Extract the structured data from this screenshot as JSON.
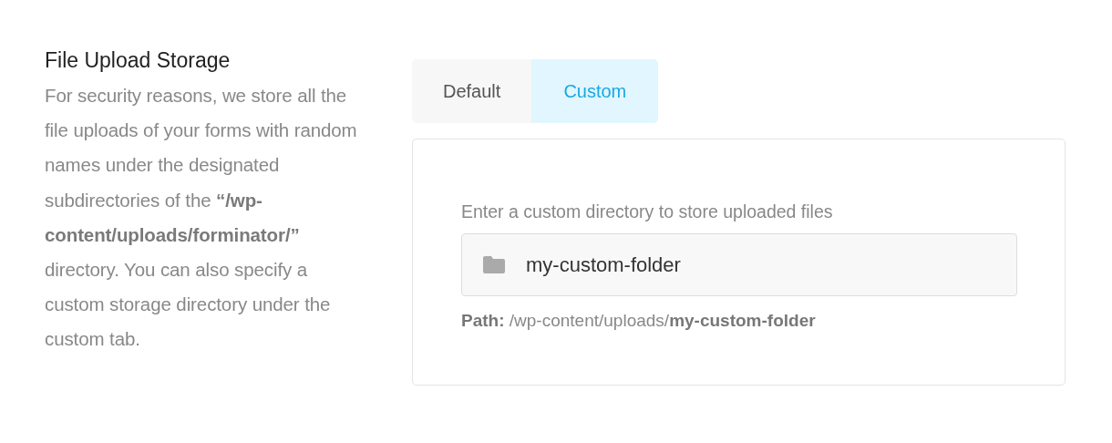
{
  "section": {
    "title": "File Upload Storage",
    "description": "For security reasons, we store all the file uploads of your forms with random names under the designated subdirectories of the **“/wp-content/uploads/forminator/”** directory. You can also specify a custom storage directory under the custom tab."
  },
  "tabs": [
    {
      "label": "Default",
      "selected": false
    },
    {
      "label": "Custom",
      "selected": true
    }
  ],
  "panel": {
    "label": "Enter a custom directory to store uploaded files",
    "field": {
      "value": "my-custom-folder"
    },
    "path": "**Path:** /wp-content/uploads/**my-custom-folder**"
  }
}
